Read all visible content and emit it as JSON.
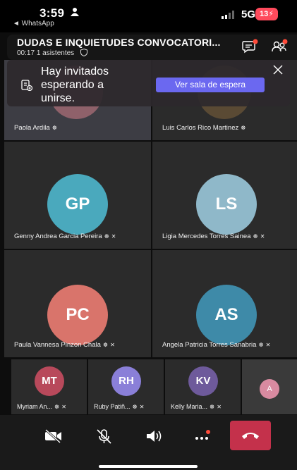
{
  "status_bar": {
    "time": "3:59",
    "back_label": "◄ WhatsApp",
    "network": "5G",
    "battery": "13"
  },
  "call": {
    "title": "DUDAS E INQUIETUDES CONVOCATORI...",
    "duration": "00:17",
    "attendees": "1 asistentes"
  },
  "lobby_notice": {
    "message": "Hay invitados esperando a unirse.",
    "button_label": "Ver sala de espera"
  },
  "participants_main": [
    {
      "name": "Paola Ardila",
      "initials": "",
      "color": "#3a3a3a"
    },
    {
      "name": "Luis Carlos Rico Martinez",
      "initials": "",
      "color": "#3a3a3a"
    },
    {
      "name": "Genny Andrea Garcia Pereira",
      "initials": "GP",
      "color": "#4aa9bd"
    },
    {
      "name": "Ligia Mercedes Torres Sainea",
      "initials": "LS",
      "color": "#8fb8c9"
    },
    {
      "name": "Paula Vannesa Pinzon Chala",
      "initials": "PC",
      "color": "#d9746b"
    },
    {
      "name": "Angela Patricia Torres Sanabria",
      "initials": "AS",
      "color": "#3e8aa8"
    }
  ],
  "participants_strip": [
    {
      "name": "Myriam An...",
      "initials": "MT",
      "color": "#b8495b"
    },
    {
      "name": "Ruby Patiñ...",
      "initials": "RH",
      "color": "#8a7fd8"
    },
    {
      "name": "Kelly Maria...",
      "initials": "KV",
      "color": "#6e5a9b"
    },
    {
      "name": "",
      "initials": "A",
      "color": "#d88aa0"
    }
  ],
  "colors": {
    "accent": "#6b68f0",
    "hangup": "#c4314b",
    "battery": "#ff4a5c",
    "notification_dot": "#ff4b3a"
  },
  "icons": {
    "camera_off": "camera-off-icon",
    "mic_off": "mic-off-icon",
    "speaker": "speaker-icon",
    "more": "more-icon",
    "hangup": "phone-hangup-icon",
    "chat": "chat-icon",
    "people": "people-icon",
    "close": "close-icon",
    "lobby": "lobby-icon"
  }
}
